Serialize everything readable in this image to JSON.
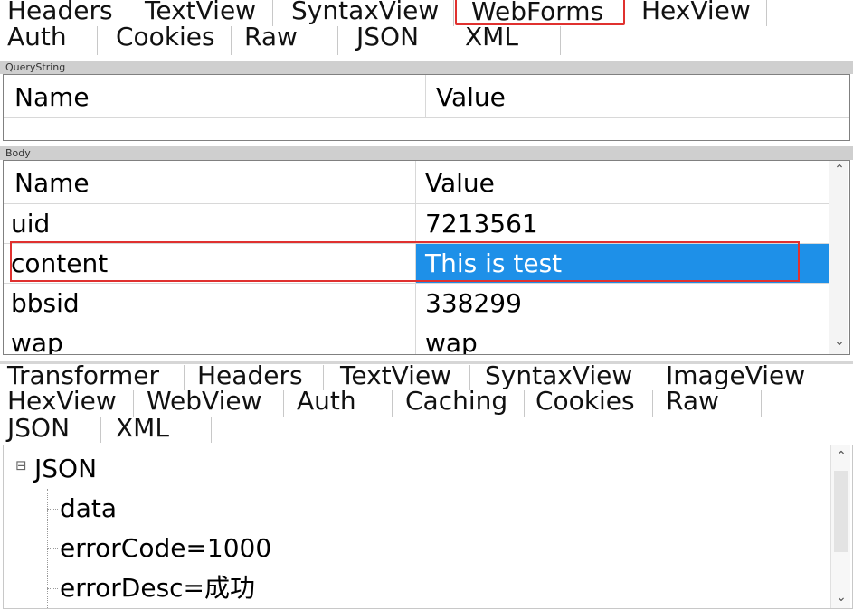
{
  "request_tabs": {
    "row1": [
      "Headers",
      "TextView",
      "SyntaxView",
      "WebForms",
      "HexView"
    ],
    "row2": [
      "Auth",
      "Cookies",
      "Raw",
      "JSON",
      "XML"
    ],
    "selected": "WebForms"
  },
  "querystring": {
    "section_label": "QueryString",
    "columns": [
      "Name",
      "Value"
    ]
  },
  "body": {
    "section_label": "Body",
    "columns": [
      "Name",
      "Value"
    ],
    "rows": [
      {
        "name": "uid",
        "value": "7213561"
      },
      {
        "name": "content",
        "value": "This is test"
      },
      {
        "name": "bbsid",
        "value": "338299"
      },
      {
        "name": "wap",
        "value": "wap"
      }
    ],
    "selected_row": "content"
  },
  "response_tabs": {
    "row1": [
      "Transformer",
      "Headers",
      "TextView",
      "SyntaxView",
      "ImageView"
    ],
    "row2": [
      "HexView",
      "WebView",
      "Auth",
      "Caching",
      "Cookies",
      "Raw"
    ],
    "row3": [
      "JSON",
      "XML"
    ],
    "selected": "JSON"
  },
  "json_tree": {
    "root": "JSON",
    "expander": "⊟",
    "children": [
      "data",
      "errorCode=1000",
      "errorDesc=成功"
    ]
  },
  "colors": {
    "selection": "#1e90e8",
    "highlight_box": "#e0312f"
  },
  "icons": {
    "scroll_up": "chevron-up-icon",
    "scroll_down": "chevron-down-icon",
    "tree_collapse": "collapse-icon"
  }
}
